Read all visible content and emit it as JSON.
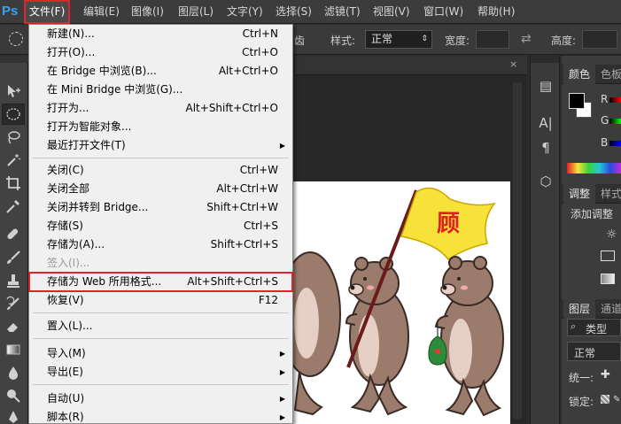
{
  "app": {
    "logo": "Ps"
  },
  "menubar": {
    "items": [
      "文件(F)",
      "编辑(E)",
      "图像(I)",
      "图层(L)",
      "文字(Y)",
      "选择(S)",
      "滤镜(T)",
      "视图(V)",
      "窗口(W)",
      "帮助(H)"
    ]
  },
  "options": {
    "clipped_label": "齿",
    "style_label": "样式:",
    "style_value": "正常",
    "width_label": "宽度:",
    "height_label": "高度:"
  },
  "file_menu": {
    "items": [
      {
        "label": "新建(N)...",
        "shortcut": "Ctrl+N"
      },
      {
        "label": "打开(O)...",
        "shortcut": "Ctrl+O"
      },
      {
        "label": "在 Bridge 中浏览(B)...",
        "shortcut": "Alt+Ctrl+O"
      },
      {
        "label": "在 Mini Bridge 中浏览(G)...",
        "shortcut": ""
      },
      {
        "label": "打开为...",
        "shortcut": "Alt+Shift+Ctrl+O"
      },
      {
        "label": "打开为智能对象...",
        "shortcut": ""
      },
      {
        "label": "最近打开文件(T)",
        "shortcut": ""
      },
      {
        "label": "关闭(C)",
        "shortcut": "Ctrl+W"
      },
      {
        "label": "关闭全部",
        "shortcut": "Alt+Ctrl+W"
      },
      {
        "label": "关闭并转到 Bridge...",
        "shortcut": "Shift+Ctrl+W"
      },
      {
        "label": "存储(S)",
        "shortcut": "Ctrl+S"
      },
      {
        "label": "存储为(A)...",
        "shortcut": "Shift+Ctrl+S"
      },
      {
        "label": "签入(I)...",
        "shortcut": ""
      },
      {
        "label": "存储为 Web 所用格式...",
        "shortcut": "Alt+Shift+Ctrl+S"
      },
      {
        "label": "恢复(V)",
        "shortcut": "F12"
      },
      {
        "label": "置入(L)...",
        "shortcut": ""
      },
      {
        "label": "导入(M)",
        "shortcut": ""
      },
      {
        "label": "导出(E)",
        "shortcut": ""
      },
      {
        "label": "自动(U)",
        "shortcut": ""
      },
      {
        "label": "脚本(R)",
        "shortcut": ""
      }
    ]
  },
  "right_panels": {
    "color_tab": "颜色",
    "swatches_tab": "色板",
    "channel_r": "R",
    "channel_g": "G",
    "channel_b": "B",
    "adjust_tab": "调整",
    "styles_tab": "样式",
    "add_adjust": "添加调整",
    "layers_tab": "图层",
    "channels_tab": "通道",
    "kind_filter": "类型",
    "blend_mode": "正常",
    "unify": "统一:",
    "lock": "锁定:"
  },
  "artwork": {
    "flag_text": "顾"
  },
  "colors": {
    "accent_highlight": "#e3232c",
    "ps_blue": "#3ea0f3",
    "flag_yellow": "#f7e23a",
    "bear_brown": "#9b7b6c"
  }
}
